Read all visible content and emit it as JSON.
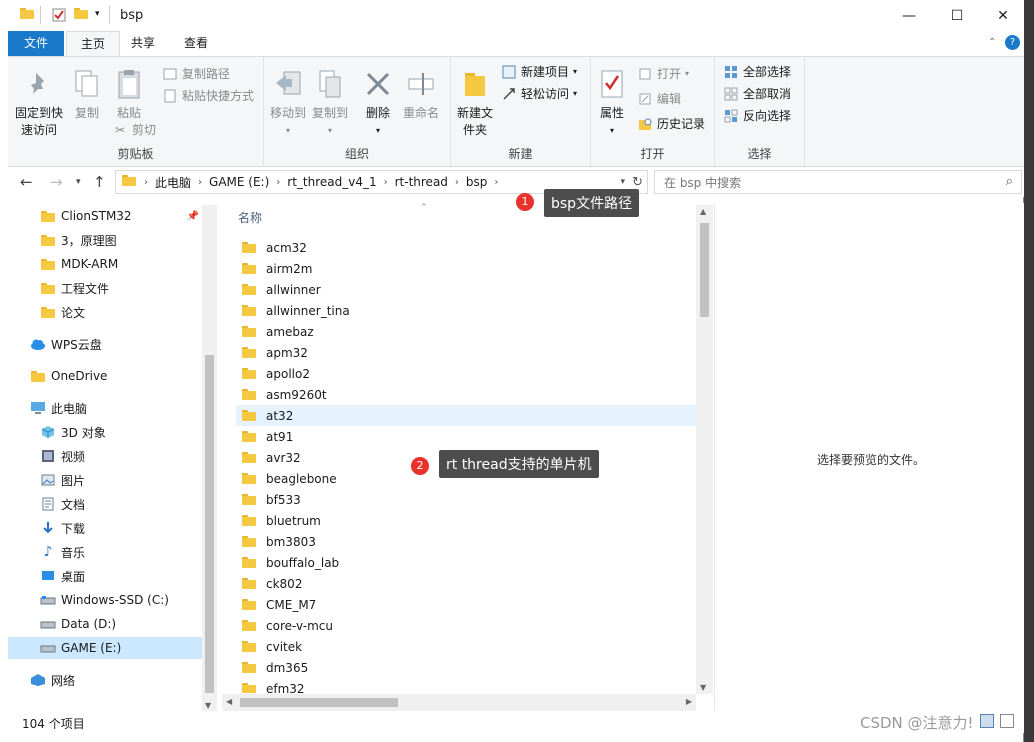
{
  "window": {
    "title": "bsp",
    "minimize": "—",
    "maximize": "☐",
    "close": "✕"
  },
  "tabs": {
    "file": "文件",
    "home": "主页",
    "share": "共享",
    "view": "查看"
  },
  "ribbon": {
    "clipboard": {
      "label": "剪贴板",
      "pin": "固定到快速访问",
      "copy": "复制",
      "paste": "粘贴",
      "copy_path": "复制路径",
      "paste_shortcut": "粘贴快捷方式",
      "cut": "剪切"
    },
    "organize": {
      "label": "组织",
      "move_to": "移动到",
      "copy_to": "复制到",
      "delete": "删除",
      "rename": "重命名"
    },
    "new": {
      "label": "新建",
      "new_folder": "新建文件夹",
      "new_item": "新建项目",
      "easy_access": "轻松访问"
    },
    "open": {
      "label": "打开",
      "properties": "属性",
      "open": "打开",
      "edit": "编辑",
      "history": "历史记录"
    },
    "select": {
      "label": "选择",
      "select_all": "全部选择",
      "select_none": "全部取消",
      "invert": "反向选择"
    }
  },
  "address": {
    "crumbs": [
      "此电脑",
      "GAME (E:)",
      "rt_thread_v4_1",
      "rt-thread",
      "bsp"
    ],
    "search_placeholder": "在 bsp 中搜索"
  },
  "nav": {
    "items": [
      {
        "label": "ClionSTM32",
        "icon": "folder-icon"
      },
      {
        "label": "3，原理图",
        "icon": "folder-icon"
      },
      {
        "label": "MDK-ARM",
        "icon": "folder-icon"
      },
      {
        "label": "工程文件",
        "icon": "folder-icon"
      },
      {
        "label": "论文",
        "icon": "folder-icon"
      },
      {
        "label": "WPS云盘",
        "icon": "cloud-icon"
      },
      {
        "label": "OneDrive",
        "icon": "folder-icon"
      },
      {
        "label": "此电脑",
        "icon": "computer-icon"
      },
      {
        "label": "3D 对象",
        "icon": "cube-icon"
      },
      {
        "label": "视频",
        "icon": "video-icon"
      },
      {
        "label": "图片",
        "icon": "picture-icon"
      },
      {
        "label": "文档",
        "icon": "document-icon"
      },
      {
        "label": "下载",
        "icon": "download-icon"
      },
      {
        "label": "音乐",
        "icon": "music-icon"
      },
      {
        "label": "桌面",
        "icon": "desktop-icon"
      },
      {
        "label": "Windows-SSD (C:)",
        "icon": "drive-icon"
      },
      {
        "label": "Data (D:)",
        "icon": "drive-icon"
      },
      {
        "label": "GAME (E:)",
        "icon": "drive-icon"
      },
      {
        "label": "网络",
        "icon": "network-icon"
      }
    ]
  },
  "content": {
    "column_name": "名称",
    "folders": [
      "acm32",
      "airm2m",
      "allwinner",
      "allwinner_tina",
      "amebaz",
      "apm32",
      "apollo2",
      "asm9260t",
      "at32",
      "at91",
      "avr32",
      "beaglebone",
      "bf533",
      "bluetrum",
      "bm3803",
      "bouffalo_lab",
      "ck802",
      "CME_M7",
      "core-v-mcu",
      "cvitek",
      "dm365",
      "efm32"
    ]
  },
  "preview": {
    "text": "选择要预览的文件。"
  },
  "status": {
    "count": "104 个项目"
  },
  "annotations": {
    "one_num": "1",
    "one_text": "bsp文件路径",
    "two_num": "2",
    "two_text": "rt thread支持的单片机"
  },
  "watermark": "CSDN @注意力!",
  "colors": {
    "file_tab": "#1979ca",
    "selection": "#cce8ff",
    "hover_row": "#e5f3ff",
    "callout": "#4d4d4d",
    "badge": "#e8322b"
  }
}
